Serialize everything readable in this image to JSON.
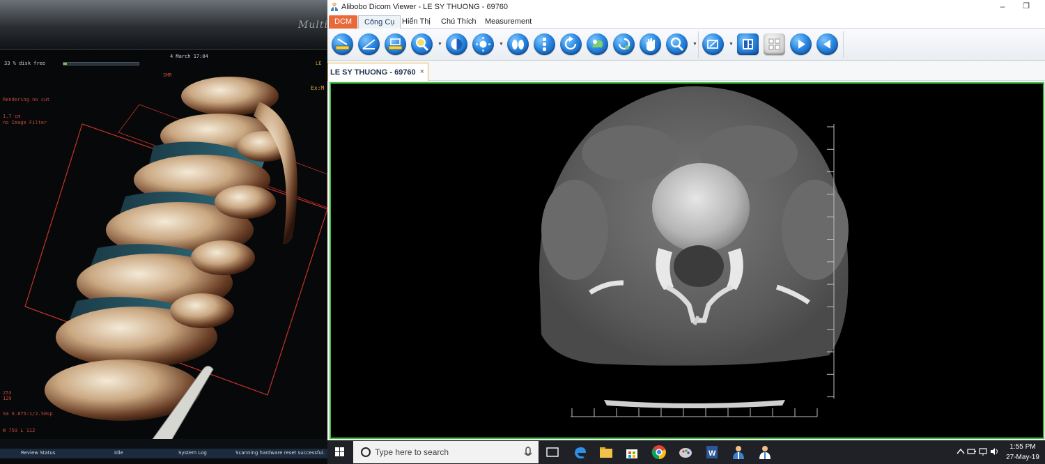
{
  "photo": {
    "brand": "Multis",
    "disk_status": "33 % disk free",
    "date": "4 March 17:04",
    "overlay_lines": [
      "Rendering no cut",
      "1.7 cm",
      "no Image Filter"
    ],
    "top_label": "SMR",
    "ex_label": "Ex:M",
    "corner_label": "LE",
    "bottom_values": [
      "253",
      "129"
    ],
    "bottom_info": "Sm 0.875:1/2.50sp",
    "wl_info": "W 759 L 112",
    "status_tabs": [
      "Review Status",
      "Idle",
      "System Log",
      "Scanning hardware reset successful."
    ]
  },
  "window": {
    "title": "Alibobo Dicom Viewer - LE SY THUONG - 69760",
    "minimize_label": "–",
    "restore_label": "❐"
  },
  "menu": {
    "dcm": "DCM",
    "tabs": [
      "Công Cụ",
      "Hiển Thị",
      "Chú Thích",
      "Measurement"
    ]
  },
  "toolbar": {
    "buttons": [
      "ruler-icon",
      "angle-icon",
      "area-icon",
      "magnify-dropdown-icon",
      "invert-icon",
      "brightness-icon",
      "lungs-icon",
      "spine-icon",
      "rotate-icon",
      "window-level-icon",
      "reset-icon",
      "pan-hand-icon",
      "zoom-icon",
      "export-icon",
      "layout-icon",
      "grid-icon",
      "next-icon",
      "previous-icon"
    ]
  },
  "doc_tab": {
    "name": "LE SY THUONG - 69760",
    "close": "×"
  },
  "taskbar": {
    "search_placeholder": "Type here to search",
    "time": "1:55 PM",
    "date": "27-May-19"
  },
  "colors": {
    "viewport_border": "#3bc23b",
    "dcm_tab": "#e8693a",
    "taskbar": "#1f2126"
  }
}
